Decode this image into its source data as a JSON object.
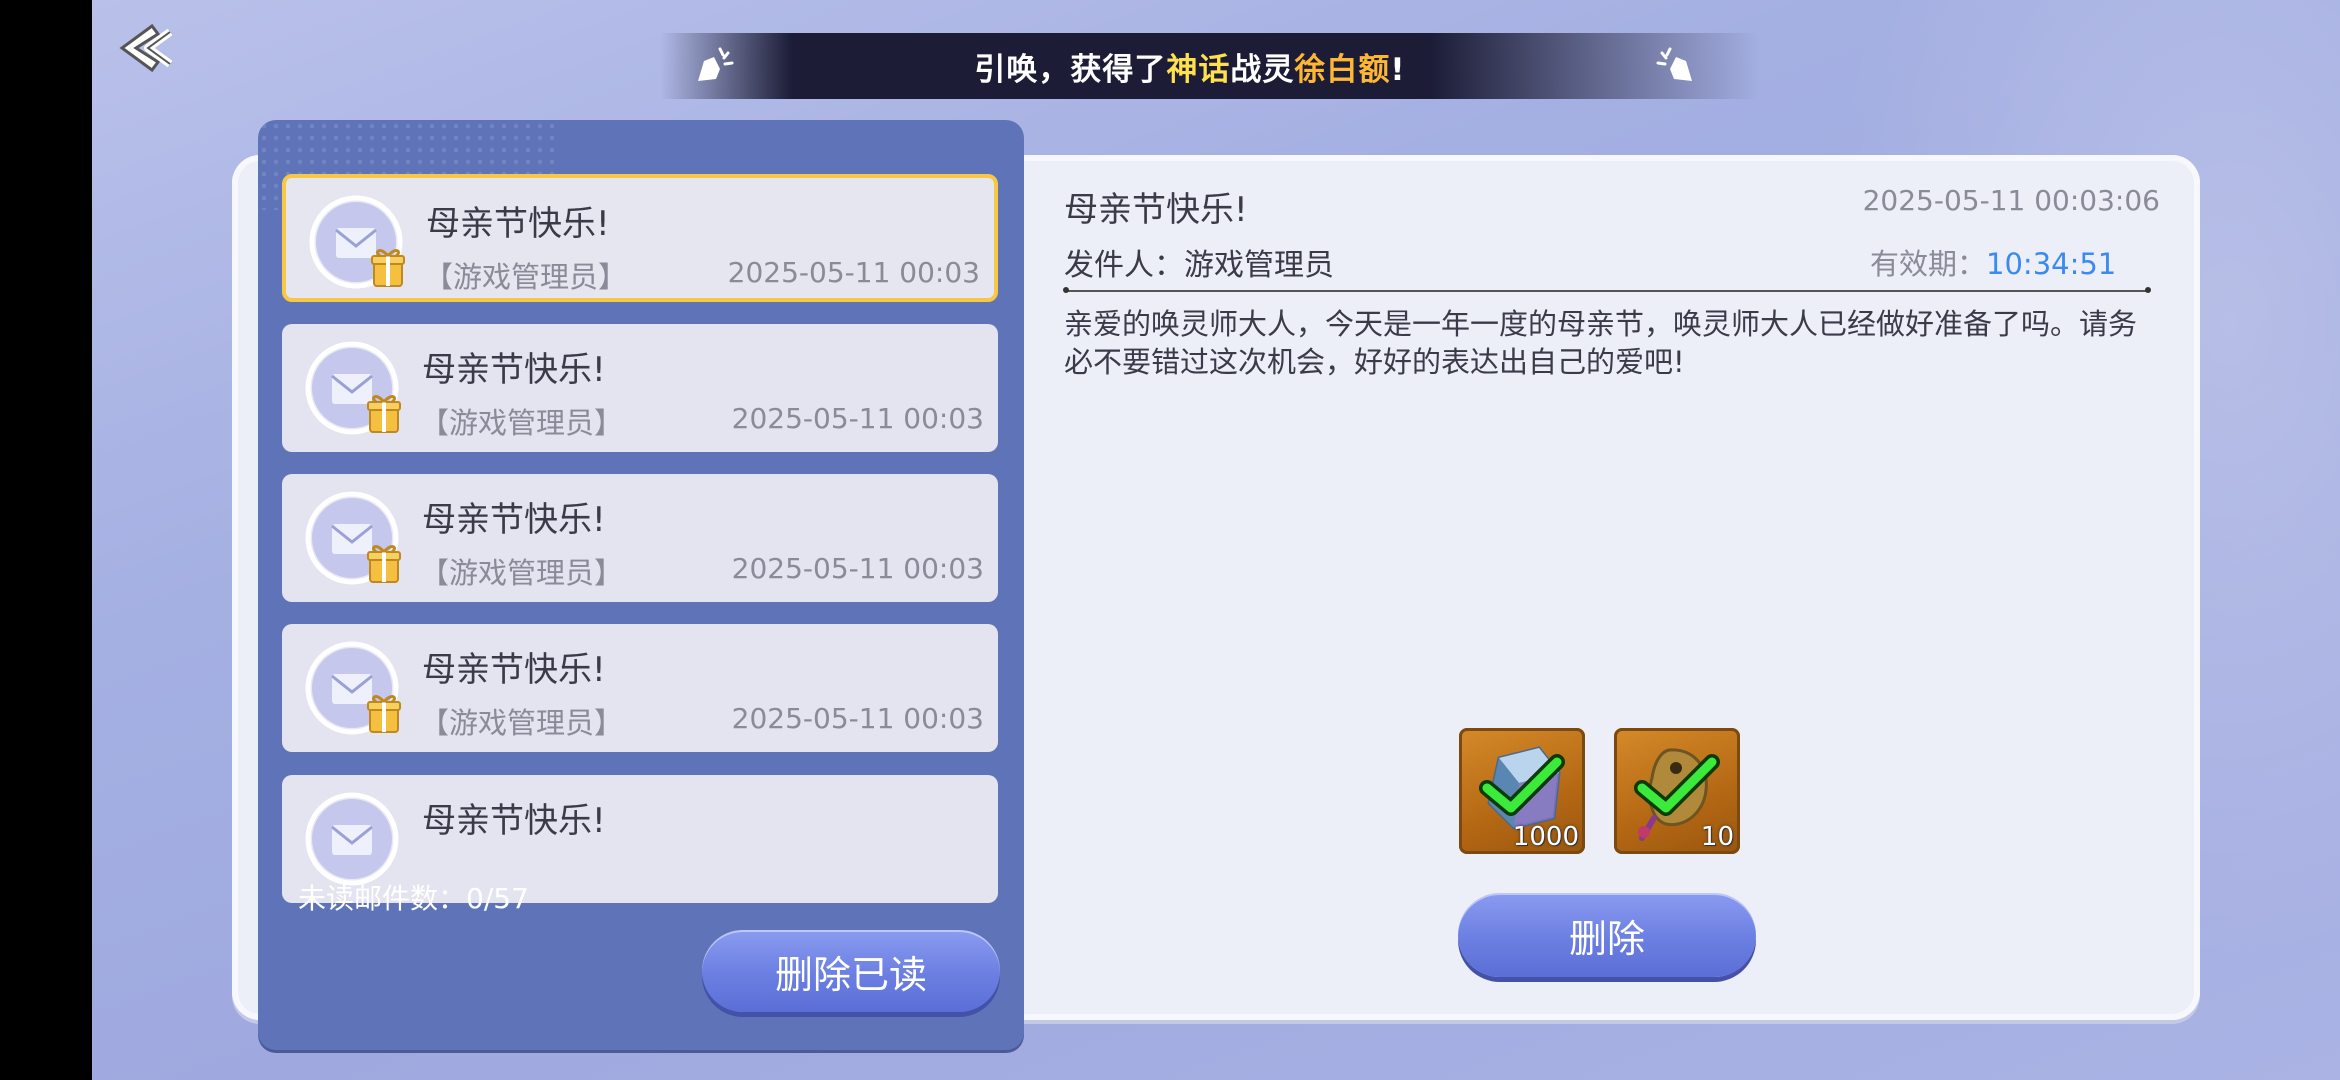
{
  "banner": {
    "prefix": "引唤，获得了",
    "rarity": "神话",
    "middle": "战灵",
    "name": "徐白额",
    "suffix": "!"
  },
  "mail_list": {
    "items": [
      {
        "title": "母亲节快乐!",
        "sender": "【游戏管理员】",
        "date": "2025-05-11 00:03",
        "selected": true
      },
      {
        "title": "母亲节快乐!",
        "sender": "【游戏管理员】",
        "date": "2025-05-11 00:03"
      },
      {
        "title": "母亲节快乐!",
        "sender": "【游戏管理员】",
        "date": "2025-05-11 00:03"
      },
      {
        "title": "母亲节快乐!",
        "sender": "【游戏管理员】",
        "date": "2025-05-11 00:03"
      },
      {
        "title": "母亲节快乐!",
        "sender": "",
        "date": ""
      }
    ],
    "unread_label": "未读邮件数：0/57",
    "delete_read_label": "删除已读"
  },
  "detail": {
    "title": "母亲节快乐!",
    "datetime": "2025-05-11 00:03:06",
    "sender_label": "发件人：游戏管理员",
    "expire_label": "有效期：",
    "expire_value": "10:34:51",
    "body": "亲爱的唤灵师大人，今天是一年一度的母亲节，唤灵师大人已经做好准备了吗。请务必不要错过这次机会，好好的表达出自己的爱吧!",
    "rewards": [
      {
        "icon": "gem-cube-icon",
        "count": "1000",
        "claimed": true
      },
      {
        "icon": "tag-charm-icon",
        "count": "10",
        "claimed": true
      }
    ],
    "delete_label": "删除"
  },
  "colors": {
    "accent": "#6b7fe2",
    "selected_border": "#f7c843",
    "expire": "#3a8af0",
    "list_panel": "#5f74b8"
  }
}
